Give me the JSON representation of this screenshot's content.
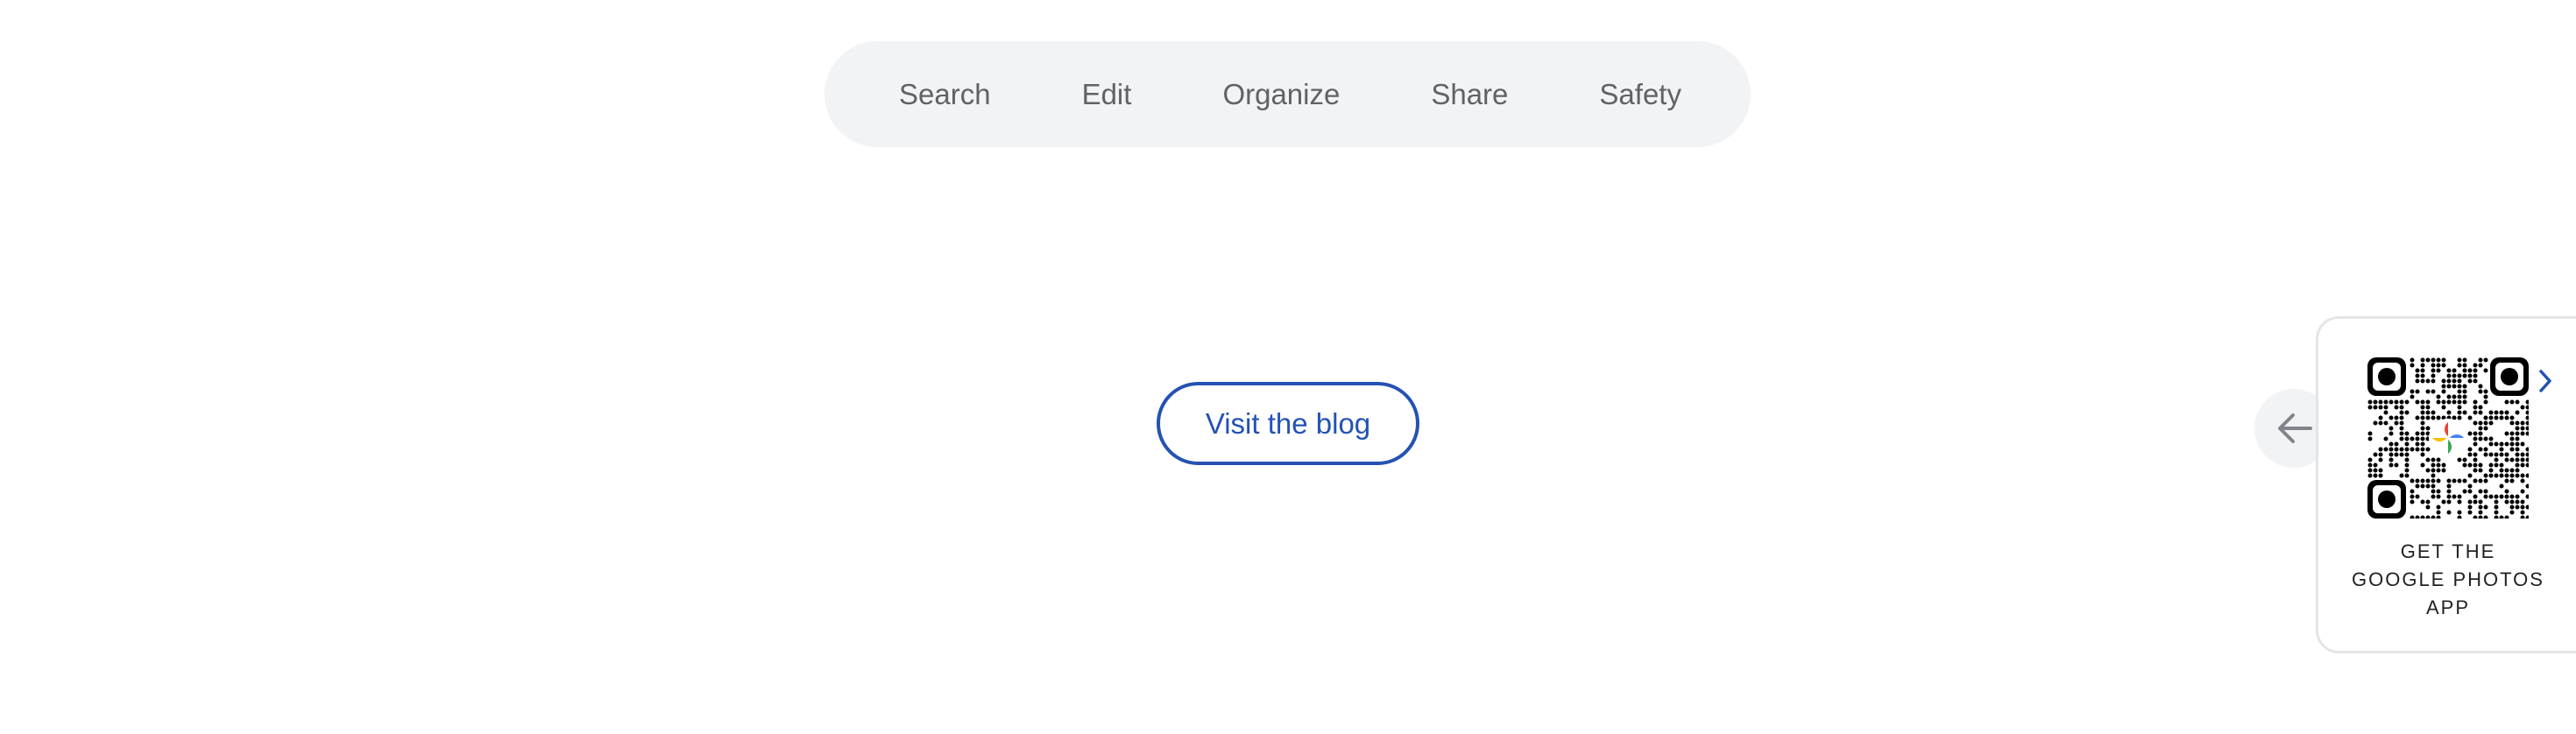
{
  "nav": {
    "items": [
      {
        "label": "Search"
      },
      {
        "label": "Edit"
      },
      {
        "label": "Organize"
      },
      {
        "label": "Share"
      },
      {
        "label": "Safety"
      }
    ]
  },
  "blog_button": {
    "label": "Visit the blog"
  },
  "app_card": {
    "caption_lines": [
      "GET THE",
      "GOOGLE PHOTOS",
      "APP"
    ]
  },
  "icons": {
    "back": "arrow-left-icon",
    "next": "chevron-right-icon",
    "qr": "qr-code-icon"
  },
  "colors": {
    "nav_bg": "#f1f3f4",
    "nav_text": "#5f6368",
    "accent_blue": "#2452b4",
    "caption_text": "#202124"
  }
}
